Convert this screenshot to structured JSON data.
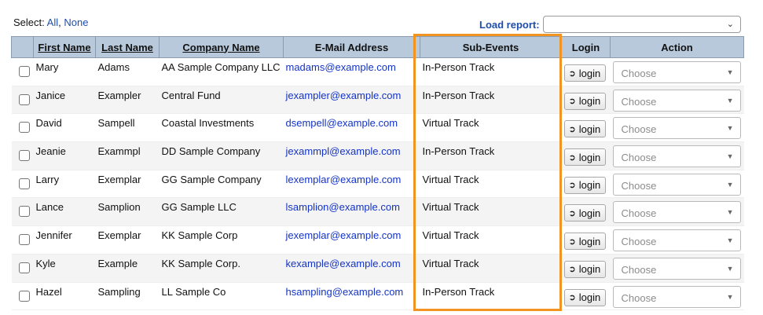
{
  "toolbar": {
    "select_label": "Select:",
    "select_all": "All",
    "select_sep": ",",
    "select_none": "None",
    "load_report_label": "Load report:",
    "load_report_value": ""
  },
  "columns": {
    "first": "First Name",
    "last": "Last Name",
    "company": "Company Name",
    "email": "E-Mail Address",
    "subevents": "Sub-Events",
    "login": "Login",
    "action": "Action"
  },
  "login_label": "login",
  "action_placeholder": "Choose",
  "rows": [
    {
      "first": "Mary",
      "last": "Adams",
      "company": "AA Sample Company LLC",
      "email": "madams@example.com",
      "subevent": "In-Person Track"
    },
    {
      "first": "Janice",
      "last": "Exampler",
      "company": "Central Fund",
      "email": "jexampler@example.com",
      "subevent": "In-Person Track"
    },
    {
      "first": "David",
      "last": "Sampell",
      "company": "Coastal Investments",
      "email": "dsempell@example.com",
      "subevent": "Virtual Track"
    },
    {
      "first": "Jeanie",
      "last": "Exammpl",
      "company": "DD Sample Company",
      "email": "jexammpl@example.com",
      "subevent": "In-Person Track"
    },
    {
      "first": "Larry",
      "last": "Exemplar",
      "company": "GG Sample Company",
      "email": "lexemplar@example.com",
      "subevent": "Virtual Track"
    },
    {
      "first": "Lance",
      "last": "Samplion",
      "company": "GG Sample LLC",
      "email": "lsamplion@example.com",
      "subevent": "Virtual Track"
    },
    {
      "first": "Jennifer",
      "last": "Exemplar",
      "company": "KK Sample Corp",
      "email": "jexemplar@example.com",
      "subevent": "Virtual Track"
    },
    {
      "first": "Kyle",
      "last": "Example",
      "company": "KK Sample Corp.",
      "email": "kexample@example.com",
      "subevent": "Virtual Track"
    },
    {
      "first": "Hazel",
      "last": "Sampling",
      "company": "LL Sample Co",
      "email": "hsampling@example.com",
      "subevent": "In-Person Track"
    }
  ],
  "colors": {
    "header_bg": "#b7c9db",
    "link": "#1f4ea8",
    "email_link": "#1333c8",
    "highlight": "#f29422"
  }
}
